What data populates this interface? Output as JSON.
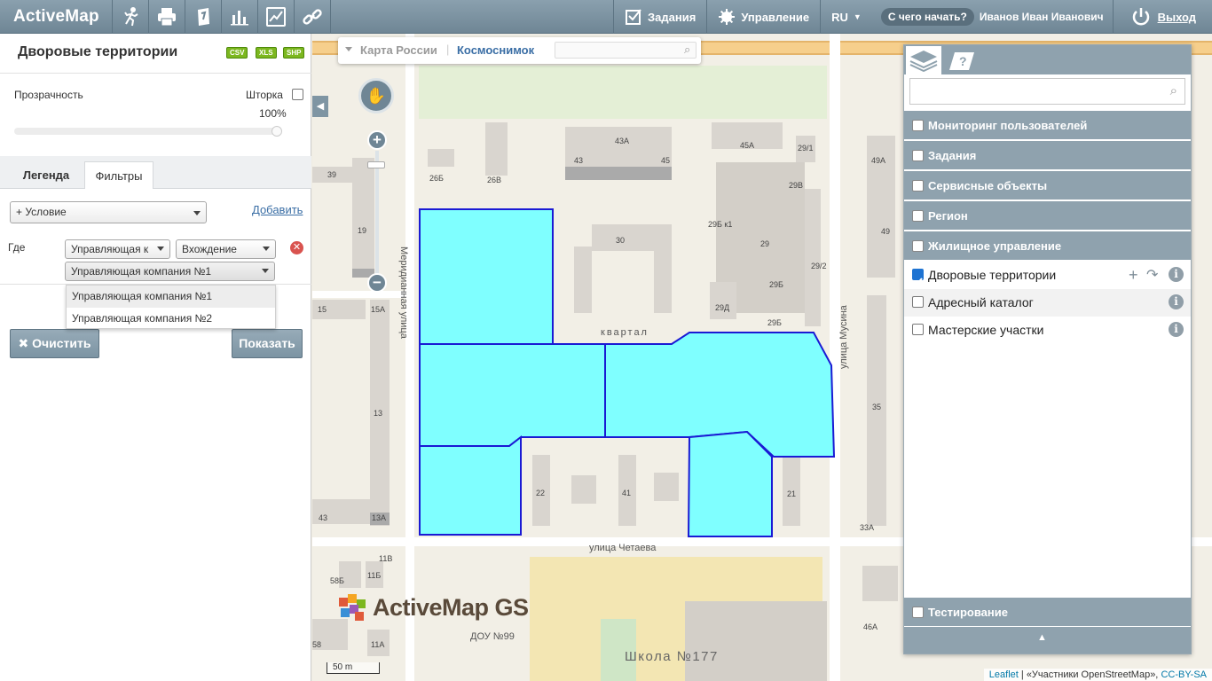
{
  "topbar": {
    "logo": "ActiveMap",
    "tools": [
      "compass-person-icon",
      "printer-icon",
      "notes-icon",
      "bar-chart-icon",
      "line-chart-icon",
      "link-icon"
    ],
    "tasks_label": "Задания",
    "manage_label": "Управление",
    "lang": "RU",
    "start_label": "С чего начать?",
    "user_name": "Иванов Иван Иванович",
    "exit_label": "Выход"
  },
  "left_panel": {
    "title": "Дворовые территории",
    "export": [
      "CSV",
      "XLS",
      "SHP"
    ],
    "transparency_label": "Прозрачность",
    "curtain_label": "Шторка",
    "transparency_value": "100%",
    "tabs": [
      "Легенда",
      "Фильтры"
    ],
    "condition_select": "+ Условие",
    "add_link": "Добавить",
    "where_label": "Где",
    "field_select": "Управляющая к",
    "operator_select": "Вхождение",
    "value_select": "Управляющая компания №1",
    "options": [
      "Управляющая компания №1",
      "Управляющая компания №2"
    ],
    "clear_button": "Очистить",
    "show_button": "Показать"
  },
  "map": {
    "basemap_label": "Карта России",
    "satellite_label": "Космоснимок",
    "street_labels": [
      "Меридианная улица",
      "улица Мусина",
      "улица Четаева"
    ],
    "block_label": "квартал",
    "school_label": "Школа №177",
    "kindergarten_label": "ДОУ №99",
    "building_numbers": [
      "39",
      "26Б",
      "26В",
      "43А",
      "43",
      "45",
      "45А",
      "29/1",
      "49А",
      "29В",
      "19",
      "30",
      "29Б к1",
      "29",
      "49",
      "29Б",
      "29/2",
      "15",
      "15А",
      "29Д",
      "35",
      "13",
      "22",
      "41",
      "21",
      "43",
      "13А",
      "33А",
      "11В",
      "58Б",
      "11Б",
      "58",
      "11А",
      "46А",
      "29Б"
    ],
    "brand": "ActiveMap GS",
    "scale": "50 m",
    "attribution_leaflet": "Leaflet",
    "attribution_osm": "«Участники OpenStreetMap»,",
    "attribution_license": "CC-BY-SA",
    "polygon_color": "#7fffff",
    "polygon_stroke": "#1a1ad4"
  },
  "layers_panel": {
    "groups": [
      "Мониторинг пользователей",
      "Задания",
      "Сервисные объекты",
      "Регион",
      "Жилищное управление"
    ],
    "items": [
      {
        "label": "Дворовые территории",
        "checked": true
      },
      {
        "label": "Адресный каталог",
        "checked": false
      },
      {
        "label": "Мастерские участки",
        "checked": false
      }
    ],
    "bottom_group": "Тестирование"
  }
}
